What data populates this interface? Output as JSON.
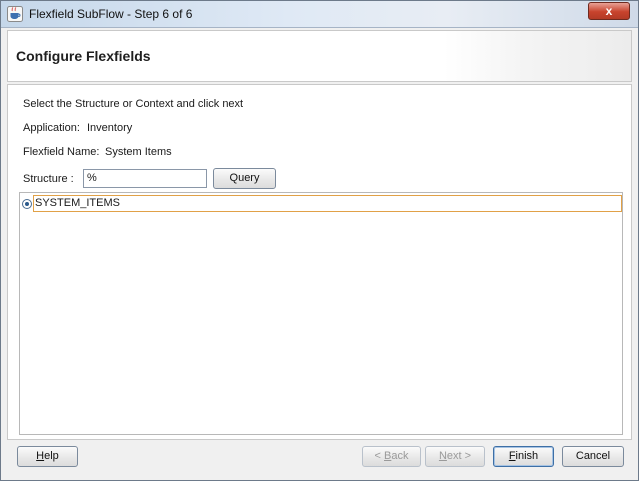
{
  "window": {
    "title": "Flexfield SubFlow - Step 6 of 6",
    "close_label": "x"
  },
  "header": {
    "title": "Configure Flexfields"
  },
  "form": {
    "instruction": "Select the Structure or Context and click next",
    "application_label": "Application:",
    "application_value": "Inventory",
    "flexfield_label": "Flexfield Name:",
    "flexfield_value": "System Items",
    "structure_label": "Structure :",
    "structure_value": "%",
    "query_label": "Query"
  },
  "list": {
    "items": [
      {
        "label": "SYSTEM_ITEMS",
        "selected": true
      }
    ]
  },
  "footer": {
    "help_mnemonic": "H",
    "help_rest": "elp",
    "back_prefix": "< ",
    "back_mnemonic": "B",
    "back_rest": "ack",
    "next_mnemonic": "N",
    "next_rest": "ext >",
    "finish_mnemonic": "F",
    "finish_rest": "inish",
    "cancel_label": "Cancel"
  },
  "colors": {
    "selection_border": "#e1a147",
    "close_button": "#c8432d"
  }
}
